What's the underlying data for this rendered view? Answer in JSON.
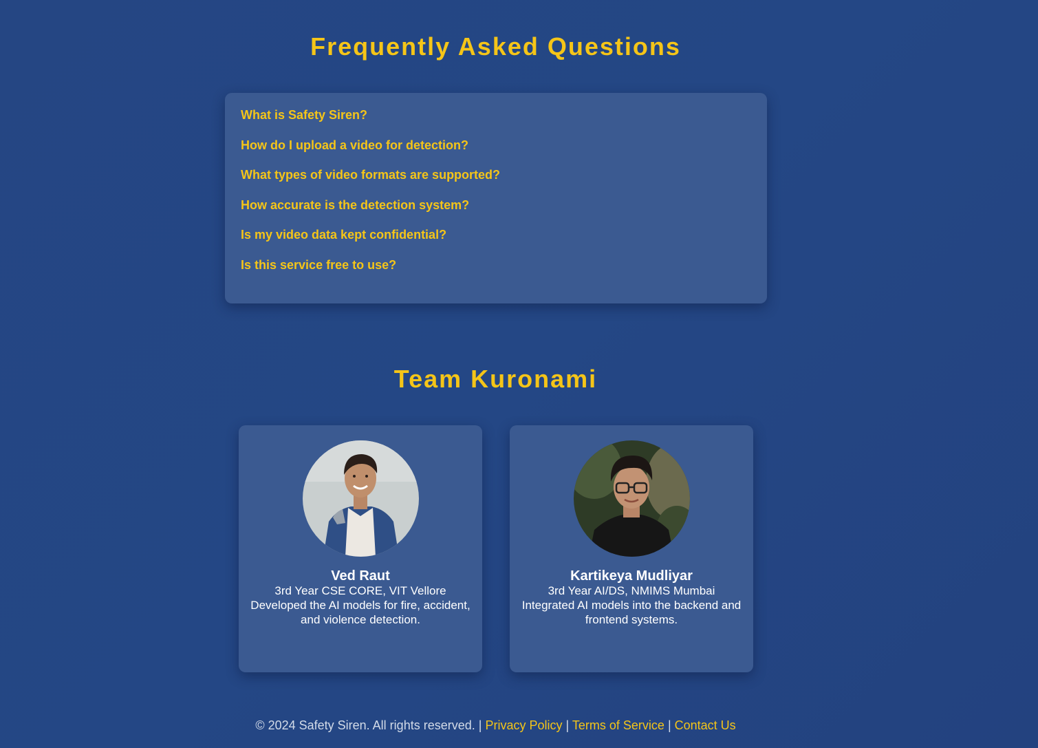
{
  "faq": {
    "title": "Frequently Asked Questions",
    "items": [
      "What is Safety Siren?",
      "How do I upload a video for detection?",
      "What types of video formats are supported?",
      "How accurate is the detection system?",
      "Is my video data kept confidential?",
      "Is this service free to use?"
    ]
  },
  "team": {
    "title": "Team Kuronami",
    "members": [
      {
        "name": "Ved Raut",
        "role": "3rd Year CSE CORE, VIT Vellore",
        "description": "Developed the AI models for fire, accident, and violence detection.",
        "photo": "member-photo-icon"
      },
      {
        "name": "Kartikeya Mudliyar",
        "role": "3rd Year AI/DS, NMIMS Mumbai",
        "description": "Integrated AI models into the backend and frontend systems.",
        "photo": "member-photo-icon"
      }
    ]
  },
  "footer": {
    "copyright": "© 2024 Safety Siren. All rights reserved.",
    "separator": "|",
    "links": [
      "Privacy Policy",
      "Terms of Service",
      "Contact Us"
    ]
  },
  "colors": {
    "background": "#244785",
    "panel": "#3b5a91",
    "accent": "#f5c518",
    "text": "#ffffff"
  }
}
